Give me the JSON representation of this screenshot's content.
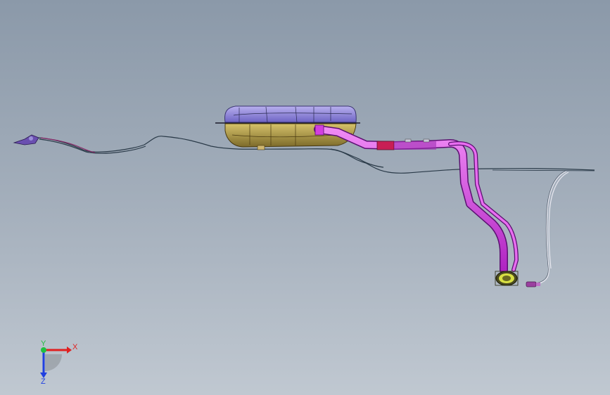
{
  "viewport": {
    "background_top": "#8b99a9",
    "background_bottom": "#c0c8d1"
  },
  "model": {
    "components": [
      {
        "name": "fuel-tank",
        "color_top": "#8f86d6",
        "color_bottom": "#a89548"
      },
      {
        "name": "filler-pipe",
        "color": "#d33fe0"
      },
      {
        "name": "filler-neck",
        "color": "#d8e043"
      },
      {
        "name": "brake-lines",
        "color": "#2a3a48"
      },
      {
        "name": "vent-hose",
        "color": "#e8e8f0"
      },
      {
        "name": "connector-front",
        "color": "#6a4fb0"
      },
      {
        "name": "connector-rear",
        "color": "#9a3f9f"
      }
    ]
  },
  "triad": {
    "x_label": "X",
    "y_label": "Y",
    "z_label": "Z",
    "x_color": "#e02020",
    "y_color": "#20c040",
    "z_color": "#2040e0"
  }
}
